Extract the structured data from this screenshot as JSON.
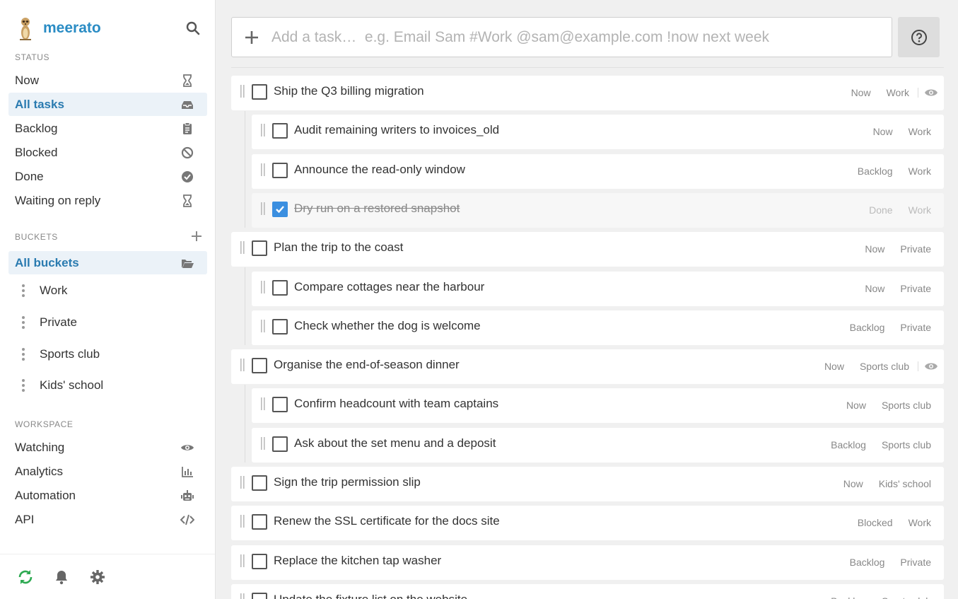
{
  "brand": {
    "name": "meerato"
  },
  "sidebar": {
    "status_heading": "STATUS",
    "status_items": [
      {
        "label": "Now",
        "icon": "hourglass-icon"
      },
      {
        "label": "All tasks",
        "icon": "inbox-icon",
        "active": true
      },
      {
        "label": "Backlog",
        "icon": "clipboard-icon"
      },
      {
        "label": "Blocked",
        "icon": "ban-icon"
      },
      {
        "label": "Done",
        "icon": "check-circle-icon"
      },
      {
        "label": "Waiting on reply",
        "icon": "hourglass-icon"
      }
    ],
    "buckets_heading": "BUCKETS",
    "all_buckets": {
      "label": "All buckets",
      "icon": "folder-open-icon",
      "active": true
    },
    "buckets": [
      "Work",
      "Private",
      "Sports club",
      "Kids' school"
    ],
    "workspace_heading": "WORKSPACE",
    "workspace_items": [
      {
        "label": "Watching",
        "icon": "eye-icon"
      },
      {
        "label": "Analytics",
        "icon": "bar-chart-icon"
      },
      {
        "label": "Automation",
        "icon": "robot-icon"
      },
      {
        "label": "API",
        "icon": "code-icon"
      }
    ]
  },
  "add_task": {
    "placeholder": "Add a task…  e.g. Email Sam #Work @sam@example.com !now next week"
  },
  "tasks": [
    {
      "title": "Ship the Q3 billing migration",
      "status": "Now",
      "bucket": "Work",
      "watched": true,
      "done": false,
      "level": 0
    },
    {
      "title": "Audit remaining writers to invoices_old",
      "status": "Now",
      "bucket": "Work",
      "watched": false,
      "done": false,
      "level": 1
    },
    {
      "title": "Announce the read-only window",
      "status": "Backlog",
      "bucket": "Work",
      "watched": false,
      "done": false,
      "level": 1
    },
    {
      "title": "Dry run on a restored snapshot",
      "status": "Done",
      "bucket": "Work",
      "watched": false,
      "done": true,
      "level": 1
    },
    {
      "title": "Plan the trip to the coast",
      "status": "Now",
      "bucket": "Private",
      "watched": false,
      "done": false,
      "level": 0
    },
    {
      "title": "Compare cottages near the harbour",
      "status": "Now",
      "bucket": "Private",
      "watched": false,
      "done": false,
      "level": 1
    },
    {
      "title": "Check whether the dog is welcome",
      "status": "Backlog",
      "bucket": "Private",
      "watched": false,
      "done": false,
      "level": 1
    },
    {
      "title": "Organise the end-of-season dinner",
      "status": "Now",
      "bucket": "Sports club",
      "watched": true,
      "done": false,
      "level": 0
    },
    {
      "title": "Confirm headcount with team captains",
      "status": "Now",
      "bucket": "Sports club",
      "watched": false,
      "done": false,
      "level": 1
    },
    {
      "title": "Ask about the set menu and a deposit",
      "status": "Backlog",
      "bucket": "Sports club",
      "watched": false,
      "done": false,
      "level": 1
    },
    {
      "title": "Sign the trip permission slip",
      "status": "Now",
      "bucket": "Kids' school",
      "watched": false,
      "done": false,
      "level": 0
    },
    {
      "title": "Renew the SSL certificate for the docs site",
      "status": "Blocked",
      "bucket": "Work",
      "watched": false,
      "done": false,
      "level": 0
    },
    {
      "title": "Replace the kitchen tap washer",
      "status": "Backlog",
      "bucket": "Private",
      "watched": false,
      "done": false,
      "level": 0
    },
    {
      "title": "Update the fixture list on the website",
      "status": "Backlog",
      "bucket": "Sports club",
      "watched": false,
      "done": false,
      "level": 0
    }
  ],
  "colors": {
    "brand": "#2a8cc4",
    "active_bg": "#ebf2f8",
    "check": "#3b8fe0",
    "sync": "#2eaa52"
  }
}
